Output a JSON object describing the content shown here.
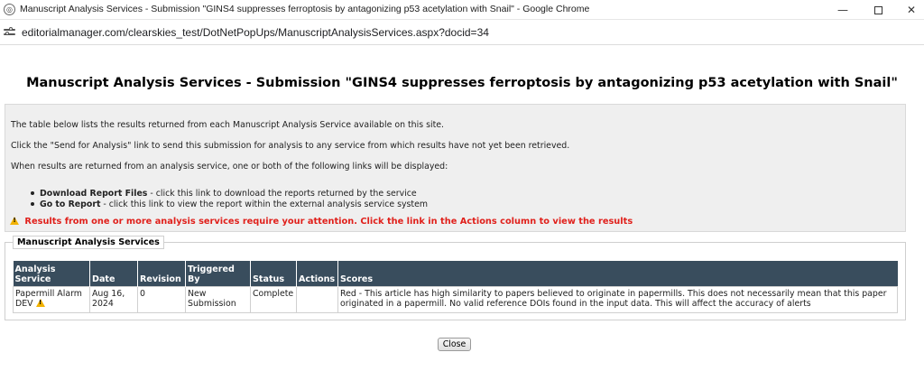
{
  "window": {
    "title": "Manuscript Analysis Services - Submission \"GINS4 suppresses ferroptosis by antagonizing p53 acetylation with Snail\" - Google Chrome",
    "minimize_glyph": "—",
    "close_glyph": "✕"
  },
  "address_bar": {
    "url": "editorialmanager.com/clearskies_test/DotNetPopUps/ManuscriptAnalysisServices.aspx?docid=34"
  },
  "page": {
    "title": "Manuscript Analysis Services - Submission \"GINS4 suppresses ferroptosis by antagonizing p53 acetylation with Snail\""
  },
  "info": {
    "line1": "The table below lists the results returned from each Manuscript Analysis Service available on this site.",
    "line2": "Click the \"Send for Analysis\" link to send this submission for analysis to any service from which results have not yet been retrieved.",
    "line3": "When results are returned from an analysis service, one or both of the following links will be displayed:",
    "links": [
      {
        "term": "Download Report Files",
        "desc": " - click this link to download the reports returned by the service"
      },
      {
        "term": "Go to Report",
        "desc": " - click this link to view the report within the external analysis service system"
      }
    ],
    "warning": "Results from one or more analysis services require your attention. Click the link in the Actions column to view the results",
    "warning_color": "#e0201b"
  },
  "services": {
    "legend": "Manuscript Analysis Services",
    "header_color": "#394d5d",
    "columns": {
      "service": "Analysis Service",
      "date": "Date",
      "revision": "Revision",
      "triggered": "Triggered By",
      "status": "Status",
      "actions": "Actions",
      "scores": "Scores"
    },
    "rows": [
      {
        "service": "Papermill Alarm DEV",
        "date": "Aug 16, 2024",
        "revision": "0",
        "triggered": "New Submission",
        "status": "Complete",
        "actions": "",
        "scores": "Red - This article has high similarity to papers believed to originate in papermills. This does not necessarily mean that this paper originated in a papermill. No valid reference DOIs found in the input data. This will affect the accuracy of alerts"
      }
    ]
  },
  "footer": {
    "close_label": "Close"
  }
}
